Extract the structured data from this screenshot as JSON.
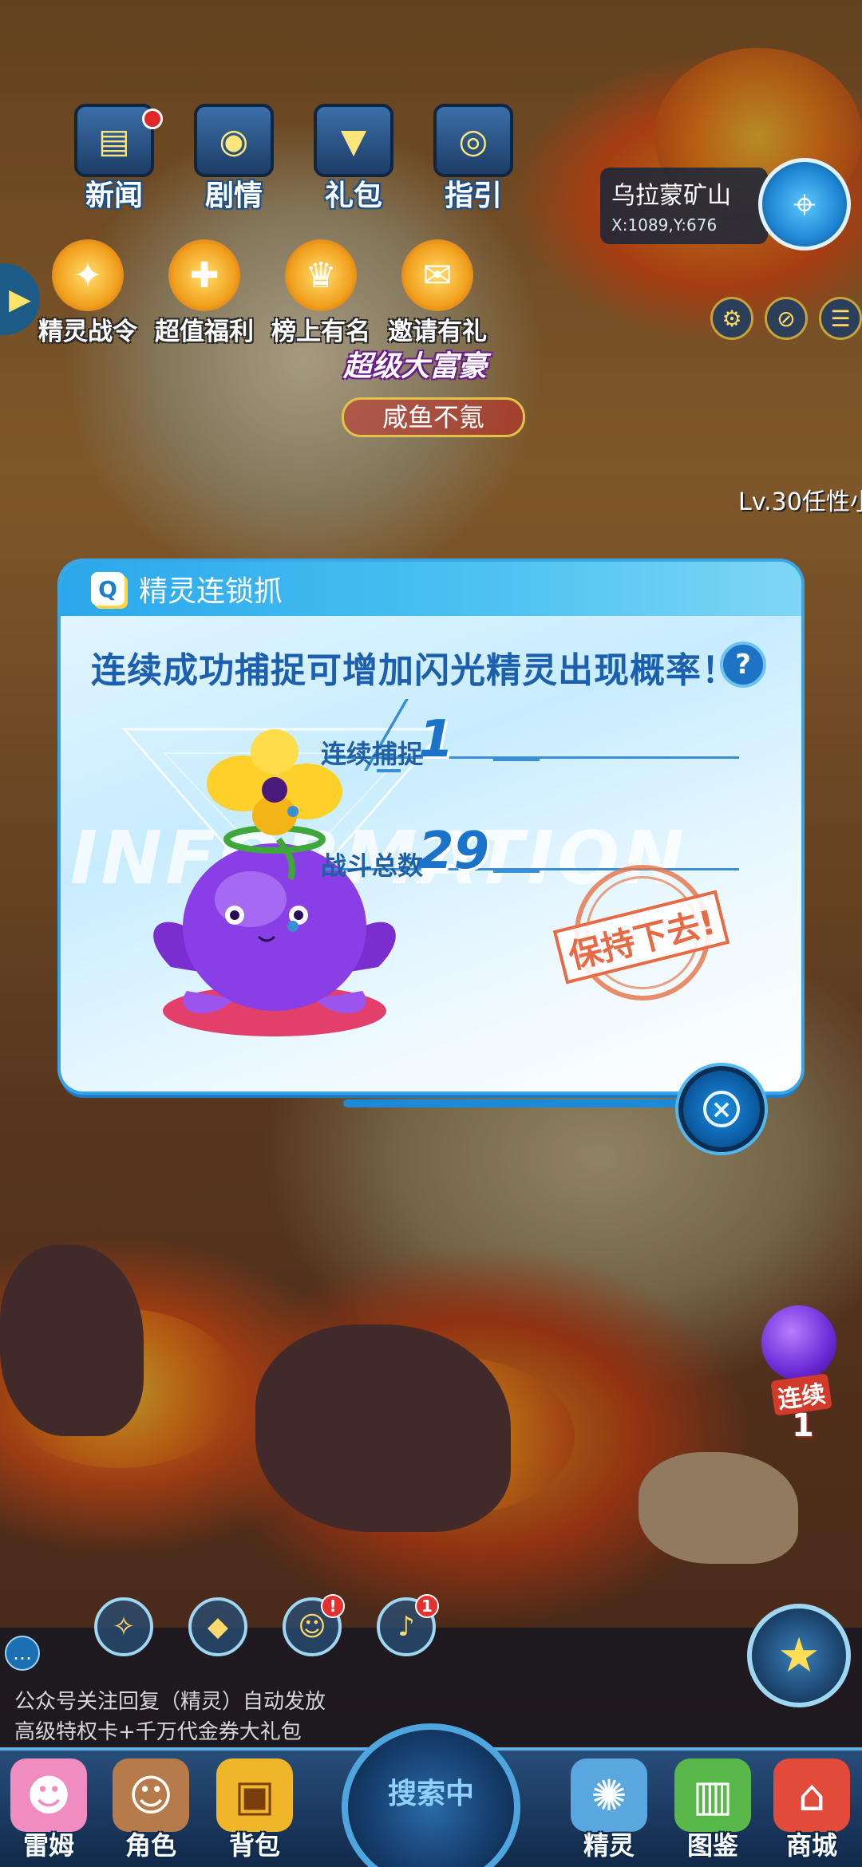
{
  "top_menu": [
    {
      "label": "新闻",
      "icon": "newspaper-icon",
      "has_dot": true
    },
    {
      "label": "剧情",
      "icon": "film-icon",
      "has_dot": false
    },
    {
      "label": "礼包",
      "icon": "giftbox-icon",
      "has_dot": false
    },
    {
      "label": "指引",
      "icon": "guide-icon",
      "has_dot": false
    }
  ],
  "second_menu": [
    {
      "label": "精灵战令",
      "icon": "trophy-icon"
    },
    {
      "label": "超值福利",
      "icon": "welfare-icon"
    },
    {
      "label": "榜上有名",
      "icon": "cup-icon"
    },
    {
      "label": "邀请有礼",
      "icon": "invite-icon"
    }
  ],
  "location": {
    "name": "乌拉蒙矿山",
    "coords": "X:1089,Y:676"
  },
  "scene": {
    "banner_title": "超级大富豪",
    "player_name": "咸鱼不氪",
    "level_tag": "Lv.30任性小"
  },
  "modal": {
    "title": "精灵连锁抓",
    "headline": "连续成功捕捉可增加闪光精灵出现概率！",
    "help_label": "?",
    "watermark": "INFORMATION",
    "stats": [
      {
        "label": "连续捕捉",
        "value": "1"
      },
      {
        "label": "战斗总数",
        "value": "29"
      }
    ],
    "stamp_text": "保持下去!"
  },
  "streak": {
    "label": "连续",
    "count": "1"
  },
  "chat": {
    "lines": [
      "公众号关注回复（精灵）自动发放",
      "高级特权卡+千万代金券大礼包"
    ]
  },
  "shortcuts": [
    {
      "icon": "compass-icon",
      "badge": ""
    },
    {
      "icon": "task-icon",
      "badge": ""
    },
    {
      "icon": "pet-face-icon",
      "badge": "!"
    },
    {
      "icon": "bell-icon",
      "badge": "1"
    }
  ],
  "bottom_nav": {
    "search_label": "搜索中",
    "items": [
      {
        "label": "雷姆",
        "icon": "pet-icon"
      },
      {
        "label": "角色",
        "icon": "character-icon"
      },
      {
        "label": "背包",
        "icon": "backpack-icon"
      },
      {
        "label": "精灵",
        "icon": "spirit-icon"
      },
      {
        "label": "图鉴",
        "icon": "album-icon"
      },
      {
        "label": "商城",
        "icon": "shop-icon"
      }
    ]
  },
  "colors": {
    "accent": "#2aa8ec",
    "headline": "#1b5fae",
    "stamp": "#e86a45",
    "pet_body": "#8a3fe6"
  }
}
